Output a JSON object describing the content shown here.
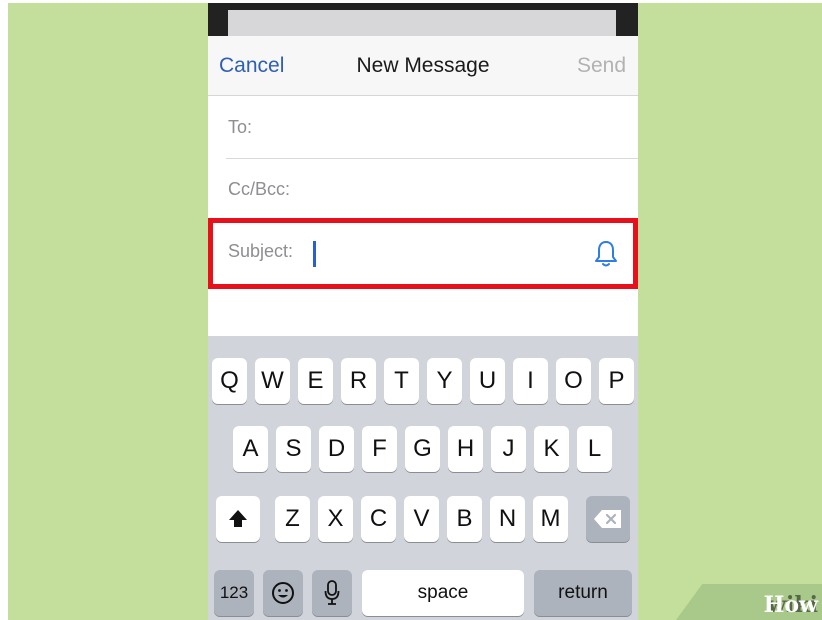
{
  "nav": {
    "cancel": "Cancel",
    "title": "New Message",
    "send": "Send"
  },
  "fields": {
    "to": "To:",
    "ccbcc": "Cc/Bcc:",
    "subject": "Subject:"
  },
  "keyboard": {
    "row1": [
      "Q",
      "W",
      "E",
      "R",
      "T",
      "Y",
      "U",
      "I",
      "O",
      "P"
    ],
    "row2": [
      "A",
      "S",
      "D",
      "F",
      "G",
      "H",
      "J",
      "K",
      "L"
    ],
    "row3": [
      "Z",
      "X",
      "C",
      "V",
      "B",
      "N",
      "M"
    ],
    "numbers": "123",
    "space": "space",
    "return": "return",
    "icons": {
      "shift": "shift-icon",
      "delete": "delete-icon",
      "emoji": "emoji-icon",
      "mic": "microphone-icon"
    }
  },
  "watermark": {
    "part1": "wiki",
    "part2": "How"
  },
  "colors": {
    "accent": "#2f5fb3",
    "highlight": "#e8101a",
    "background": "#c4df9b"
  }
}
